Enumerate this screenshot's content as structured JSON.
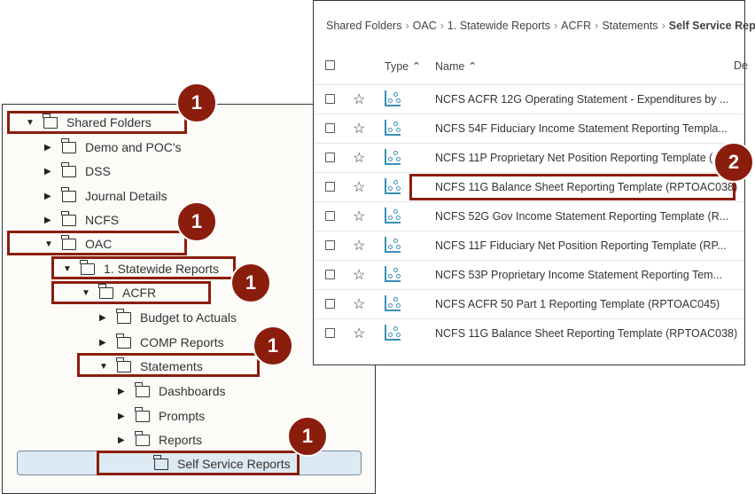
{
  "tree": [
    {
      "label": "Shared Folders",
      "level": 0,
      "expanded": true
    },
    {
      "label": "Demo and POC's",
      "level": 1,
      "expanded": false
    },
    {
      "label": "DSS",
      "level": 1,
      "expanded": false
    },
    {
      "label": "Journal Details",
      "level": 1,
      "expanded": false
    },
    {
      "label": "NCFS",
      "level": 1,
      "expanded": false
    },
    {
      "label": "OAC",
      "level": 1,
      "expanded": true
    },
    {
      "label": "1. Statewide Reports",
      "level": 2,
      "expanded": true
    },
    {
      "label": "ACFR",
      "level": 3,
      "expanded": true
    },
    {
      "label": "Budget to Actuals",
      "level": 4,
      "expanded": false
    },
    {
      "label": "COMP Reports",
      "level": 4,
      "expanded": false
    },
    {
      "label": "Statements",
      "level": 4,
      "expanded": true
    },
    {
      "label": "Dashboards",
      "level": 5,
      "expanded": false
    },
    {
      "label": "Prompts",
      "level": 5,
      "expanded": false
    },
    {
      "label": "Reports",
      "level": 5,
      "expanded": false
    },
    {
      "label": "Self Service Reports",
      "level": 6,
      "selected": true
    }
  ],
  "breadcrumb": [
    "Shared Folders",
    "OAC",
    "1. Statewide Reports",
    "ACFR",
    "Statements",
    "Self Service Reports"
  ],
  "table": {
    "headers": {
      "type": "Type",
      "name": "Name",
      "desc": "De"
    },
    "rows": [
      "NCFS ACFR 12G Operating Statement - Expenditures by ...",
      "NCFS 54F Fiduciary Income Statement Reporting Templa...",
      "NCFS 11P Proprietary Net Position Reporting Template (...",
      "NCFS 11G Balance Sheet Reporting Template (RPTOAC038)",
      "NCFS 52G Gov Income Statement Reporting Template (R...",
      "NCFS 11F Fiduciary Net Position Reporting Template (RP...",
      "NCFS 53P Proprietary Income Statement Reporting Tem...",
      "NCFS ACFR 50 Part 1 Reporting Template (RPTOAC045)",
      "NCFS 11G Balance Sheet Reporting Template (RPTOAC038)"
    ]
  },
  "callouts": {
    "step1": "1",
    "step2": "2"
  },
  "colors": {
    "callout": "#8b1d0d",
    "selected": "#dde9f3"
  }
}
